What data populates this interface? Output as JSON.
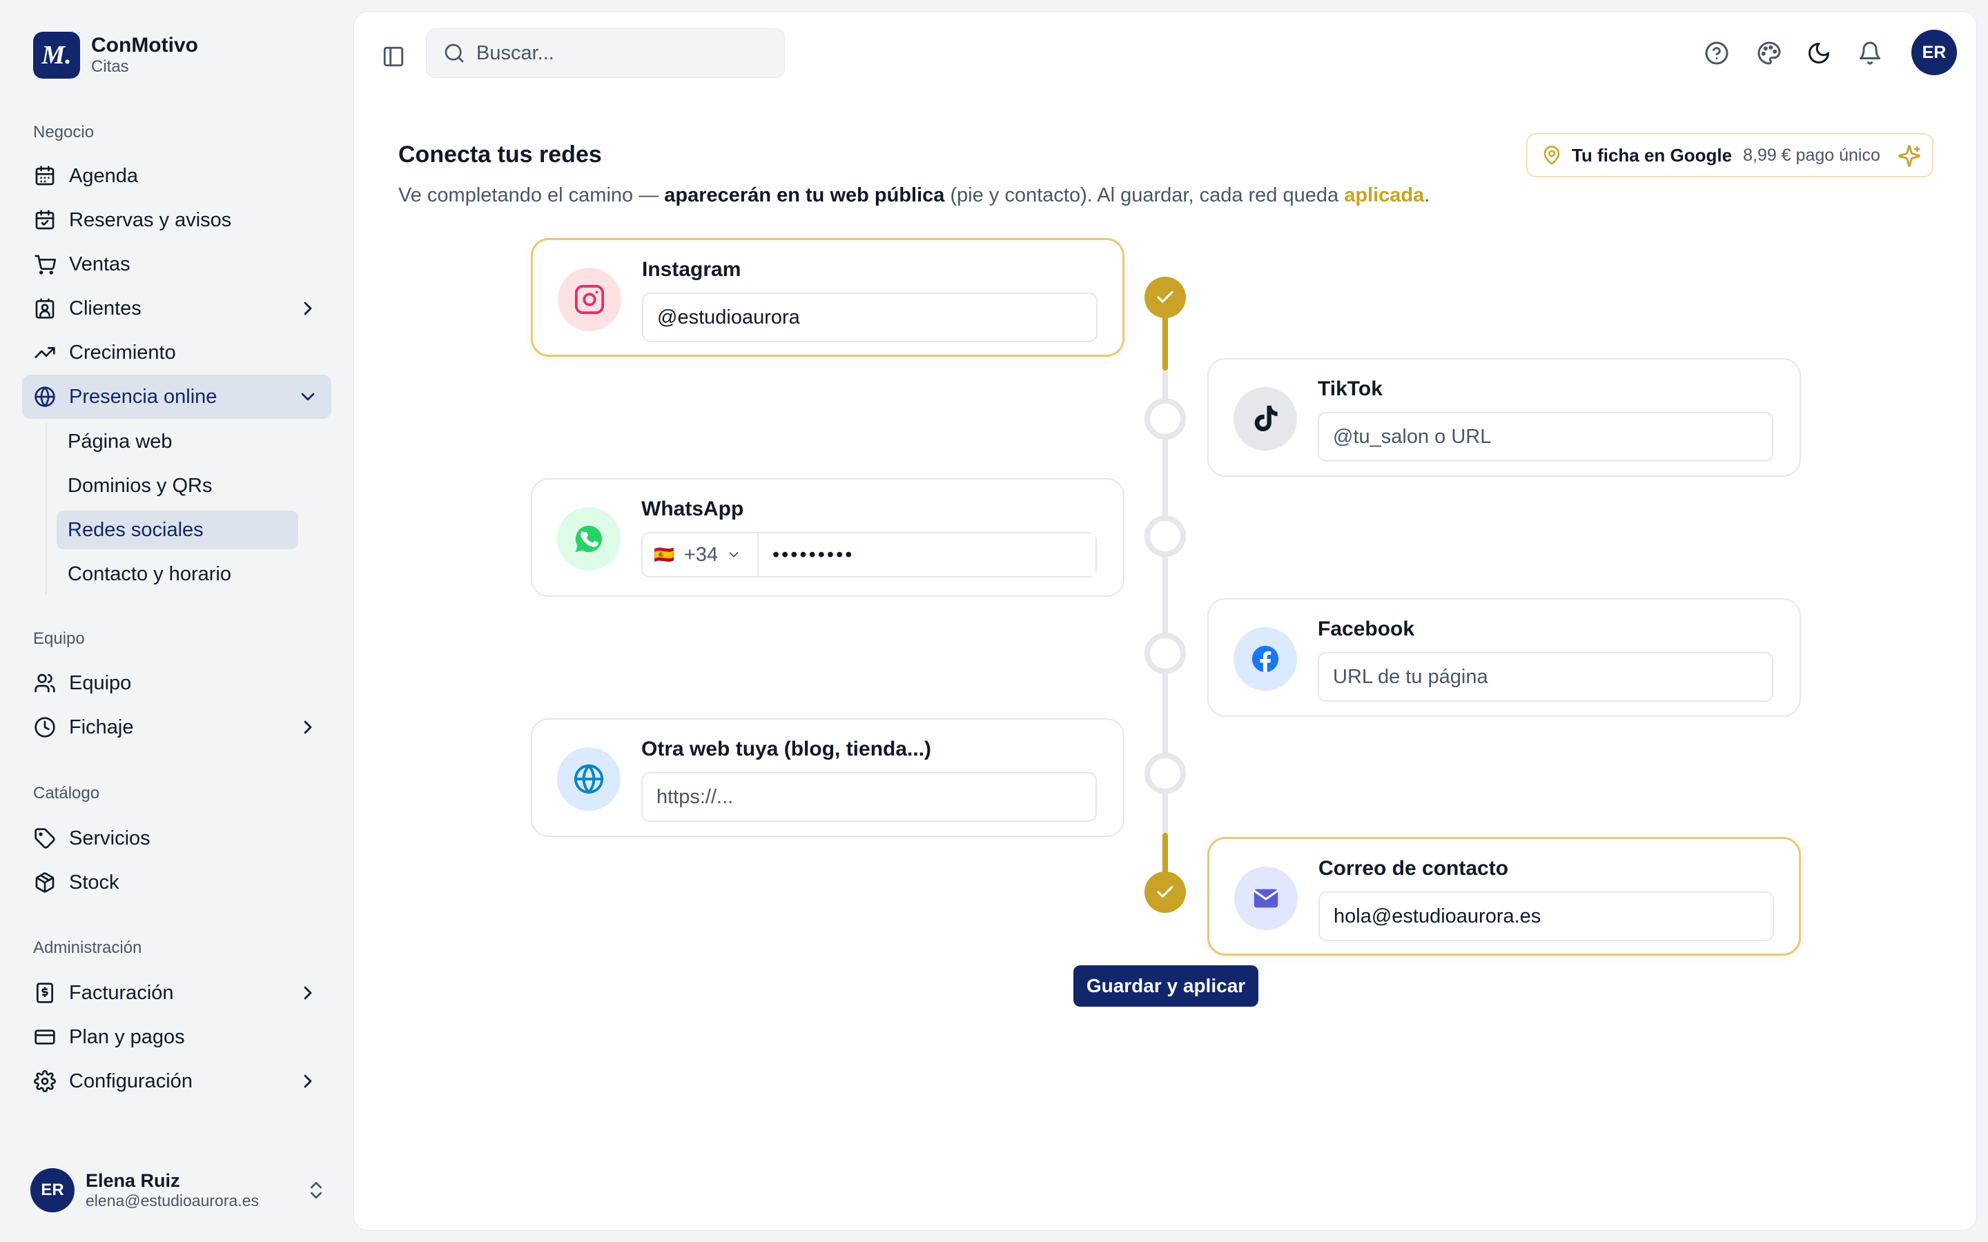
{
  "brand": {
    "logo_text": "M.",
    "name": "ConMotivo",
    "subtitle": "Citas"
  },
  "sidebar": {
    "sections": [
      {
        "label": "Negocio"
      },
      {
        "label": "Equipo"
      },
      {
        "label": "Catálogo"
      },
      {
        "label": "Administración"
      }
    ],
    "items": {
      "agenda": "Agenda",
      "reservas": "Reservas y avisos",
      "ventas": "Ventas",
      "clientes": "Clientes",
      "crecimiento": "Crecimiento",
      "presencia": "Presencia online",
      "equipo": "Equipo",
      "fichaje": "Fichaje",
      "servicios": "Servicios",
      "stock": "Stock",
      "facturacion": "Facturación",
      "plan": "Plan y pagos",
      "configuracion": "Configuración"
    },
    "presencia_sub": {
      "pagina_web": "Página web",
      "dominios": "Dominios y QRs",
      "redes": "Redes sociales",
      "contacto": "Contacto y horario"
    },
    "active_item": "Redes sociales"
  },
  "user": {
    "initials": "ER",
    "name": "Elena Ruiz",
    "email": "elena@estudioaurora.es"
  },
  "topbar": {
    "search_placeholder": "Buscar...",
    "avatar_initials": "ER",
    "icons": [
      "sidebar-toggle-icon",
      "help-icon",
      "palette-icon",
      "moon-icon",
      "bell-icon"
    ]
  },
  "page": {
    "title": "Conecta tus redes",
    "desc_1": "Ve completando el camino — ",
    "desc_bold": "aparecerán en tu web pública",
    "desc_2": " (pie y contacto). Al guardar, cada red queda ",
    "desc_accent": "aplicada",
    "desc_end": "."
  },
  "google_chip": {
    "title": "Tu ficha en Google",
    "price": "8,99 € pago único"
  },
  "networks": {
    "instagram": {
      "title": "Instagram",
      "value": "@estudioaurora",
      "placeholder": "",
      "done": true
    },
    "tiktok": {
      "title": "TikTok",
      "value": "",
      "placeholder": "@tu_salon o URL",
      "done": false
    },
    "whatsapp": {
      "title": "WhatsApp",
      "country_flag": "🇪🇸",
      "prefix": "+34",
      "value": "•••••••••",
      "done": false
    },
    "facebook": {
      "title": "Facebook",
      "value": "",
      "placeholder": "URL de tu página",
      "done": false
    },
    "web": {
      "title": "Otra web tuya (blog, tienda...)",
      "value": "",
      "placeholder": "https://...",
      "done": false
    },
    "email": {
      "title": "Correo de contacto",
      "value": "hola@estudioaurora.es",
      "placeholder": "",
      "done": true
    }
  },
  "save_button": "Guardar y aplicar",
  "colors": {
    "brand_navy": "#12266b",
    "accent_gold": "#c9a227",
    "active_bg": "#dde3ec",
    "rail_gray": "#e5e7eb"
  }
}
